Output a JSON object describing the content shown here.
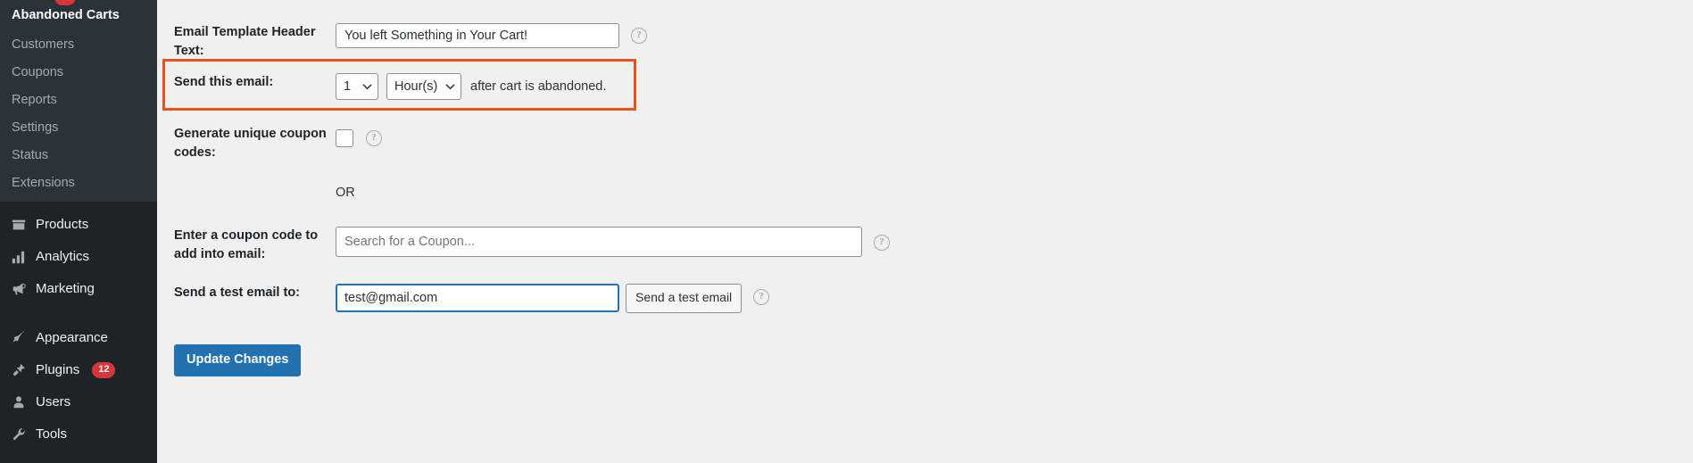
{
  "sidebar": {
    "submenu": {
      "title": "Abandoned Carts",
      "items": [
        {
          "label": "Customers",
          "icon": "none"
        },
        {
          "label": "Coupons",
          "icon": "none"
        },
        {
          "label": "Reports",
          "icon": "none"
        },
        {
          "label": "Settings",
          "icon": "none"
        },
        {
          "label": "Status",
          "icon": "none"
        },
        {
          "label": "Extensions",
          "icon": "none"
        }
      ]
    },
    "main_items": [
      {
        "label": "Products",
        "icon": "products-icon",
        "badge": ""
      },
      {
        "label": "Analytics",
        "icon": "analytics-icon",
        "badge": ""
      },
      {
        "label": "Marketing",
        "icon": "marketing-icon",
        "badge": ""
      },
      {
        "label": "Appearance",
        "icon": "appearance-icon",
        "badge": ""
      },
      {
        "label": "Plugins",
        "icon": "plugins-icon",
        "badge": "12"
      },
      {
        "label": "Users",
        "icon": "users-icon",
        "badge": ""
      },
      {
        "label": "Tools",
        "icon": "tools-icon",
        "badge": ""
      }
    ]
  },
  "form": {
    "header_text": {
      "label": "Email Template Header Text:",
      "value": "You left Something in Your Cart!",
      "help": "?"
    },
    "send_timing": {
      "label": "Send this email:",
      "amount_value": "1",
      "unit_value": "Hour(s)",
      "suffix": "after cart is abandoned."
    },
    "unique_coupon": {
      "label": "Generate unique coupon codes:",
      "checked": false,
      "help": "?"
    },
    "or_divider": "OR",
    "coupon_code": {
      "label": "Enter a coupon code to add into email:",
      "value": "",
      "placeholder": "Search for a Coupon...",
      "help": "?"
    },
    "test_email": {
      "label": "Send a test email to:",
      "value": "test@gmail.com",
      "button_label": "Send a test email",
      "help": "?"
    },
    "submit_label": "Update Changes"
  },
  "colors": {
    "sidebar_bg": "#1d2327",
    "submenu_bg": "#2c3338",
    "accent_blue": "#2271b1",
    "badge_red": "#d63638",
    "annotation_orange": "#e8521f",
    "content_bg": "#f0f0f1"
  }
}
